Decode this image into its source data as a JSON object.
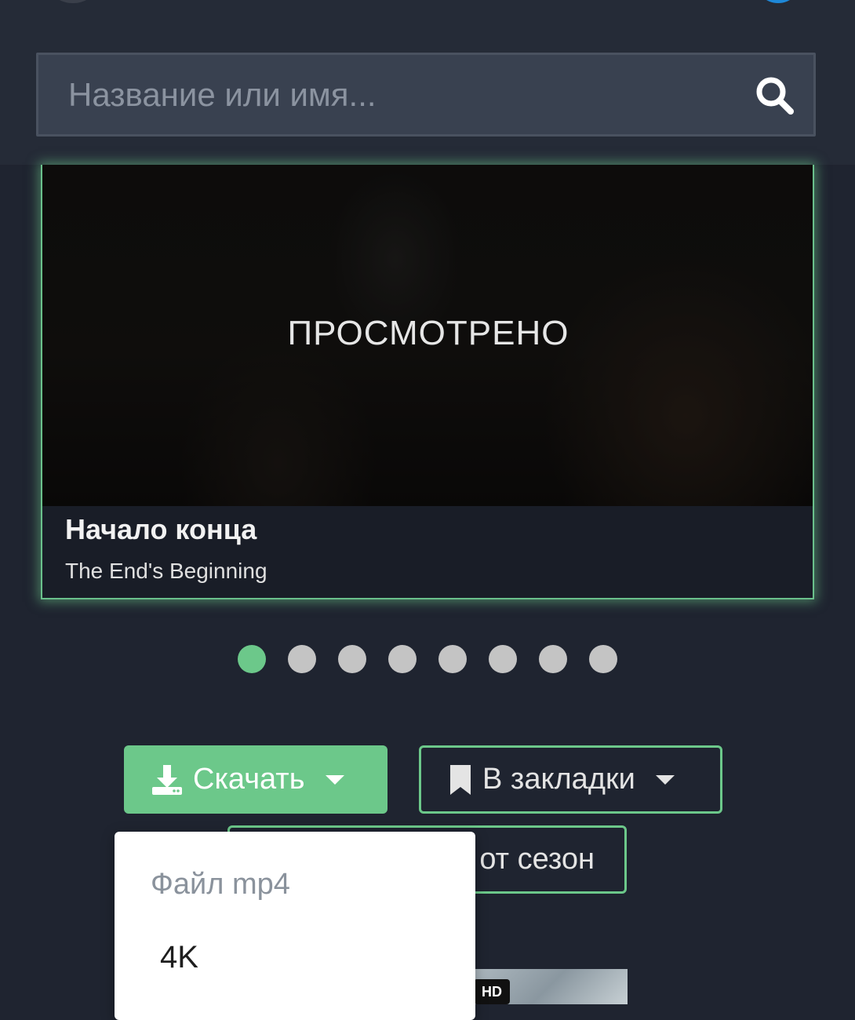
{
  "search": {
    "placeholder": "Название или имя..."
  },
  "episode": {
    "status_overlay": "ПРОСМОТРЕНО",
    "title": "Начало конца",
    "original_title": "The End's Beginning"
  },
  "carousel": {
    "dot_count": 8,
    "active_index": 0,
    "active_color": "#6cc88a",
    "inactive_color": "#c4c4c4"
  },
  "actions": {
    "download_label": "Скачать",
    "bookmark_label": "В закладки",
    "season_label_visible": "от сезон"
  },
  "download_menu": {
    "header": "Файл mp4",
    "items": [
      "4K"
    ]
  },
  "icons": {
    "search": "search-icon",
    "download": "download-icon",
    "bookmark": "bookmark-icon"
  },
  "colors": {
    "accent": "#6cc88a",
    "background": "#1f2430",
    "header": "#252b37"
  }
}
